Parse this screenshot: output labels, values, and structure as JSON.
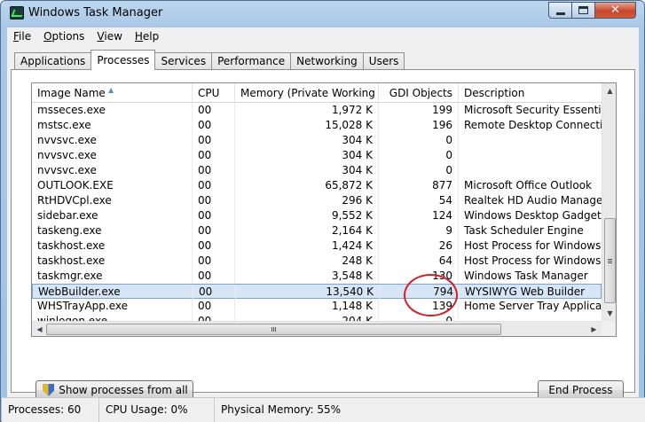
{
  "window": {
    "title": "Windows Task Manager"
  },
  "menu": [
    {
      "accel": "F",
      "rest": "ile"
    },
    {
      "accel": "O",
      "rest": "ptions"
    },
    {
      "accel": "V",
      "rest": "iew"
    },
    {
      "accel": "H",
      "rest": "elp"
    }
  ],
  "tabs": [
    "Applications",
    "Processes",
    "Services",
    "Performance",
    "Networking",
    "Users"
  ],
  "active_tab": "Processes",
  "columns": [
    "Image Name",
    "CPU",
    "Memory (Private Working Set)",
    "GDI Objects",
    "Description"
  ],
  "rows": [
    {
      "name": "msseces.exe",
      "cpu": "00",
      "mem": "1,972 K",
      "gdi": "199",
      "desc": "Microsoft Security Essentials User"
    },
    {
      "name": "mstsc.exe",
      "cpu": "00",
      "mem": "15,028 K",
      "gdi": "196",
      "desc": "Remote Desktop Connection"
    },
    {
      "name": "nvvsvc.exe",
      "cpu": "00",
      "mem": "304 K",
      "gdi": "0",
      "desc": ""
    },
    {
      "name": "nvvsvc.exe",
      "cpu": "00",
      "mem": "304 K",
      "gdi": "0",
      "desc": ""
    },
    {
      "name": "nvvsvc.exe",
      "cpu": "00",
      "mem": "304 K",
      "gdi": "0",
      "desc": ""
    },
    {
      "name": "OUTLOOK.EXE",
      "cpu": "00",
      "mem": "65,872 K",
      "gdi": "877",
      "desc": "Microsoft Office Outlook"
    },
    {
      "name": "RtHDVCpl.exe",
      "cpu": "00",
      "mem": "296 K",
      "gdi": "54",
      "desc": "Realtek HD Audio Manager"
    },
    {
      "name": "sidebar.exe",
      "cpu": "00",
      "mem": "9,552 K",
      "gdi": "124",
      "desc": "Windows Desktop Gadgets"
    },
    {
      "name": "taskeng.exe",
      "cpu": "00",
      "mem": "2,164 K",
      "gdi": "9",
      "desc": "Task Scheduler Engine"
    },
    {
      "name": "taskhost.exe",
      "cpu": "00",
      "mem": "1,424 K",
      "gdi": "26",
      "desc": "Host Process for Windows Tasks"
    },
    {
      "name": "taskhost.exe",
      "cpu": "00",
      "mem": "248 K",
      "gdi": "64",
      "desc": "Host Process for Windows Tasks"
    },
    {
      "name": "taskmgr.exe",
      "cpu": "00",
      "mem": "3,548 K",
      "gdi": "130",
      "desc": "Windows Task Manager"
    },
    {
      "name": "WebBuilder.exe",
      "cpu": "00",
      "mem": "13,540 K",
      "gdi": "794",
      "desc": "WYSIWYG Web Builder",
      "selected": true
    },
    {
      "name": "WHSTrayApp.exe",
      "cpu": "00",
      "mem": "1,148 K",
      "gdi": "139",
      "desc": "Home Server Tray Application"
    },
    {
      "name": "winlogon.exe",
      "cpu": "00",
      "mem": "204 K",
      "gdi": "0",
      "desc": ""
    }
  ],
  "buttons": {
    "show_all": "Show processes from all users",
    "end_process": "End Process"
  },
  "status": {
    "processes": "Processes: 60",
    "cpu": "CPU Usage: 0%",
    "memory": "Physical Memory: 55%"
  },
  "colors": {
    "annotation": "#d21f25",
    "selection": "#d7e6f7",
    "close_button": "#c8462c"
  }
}
